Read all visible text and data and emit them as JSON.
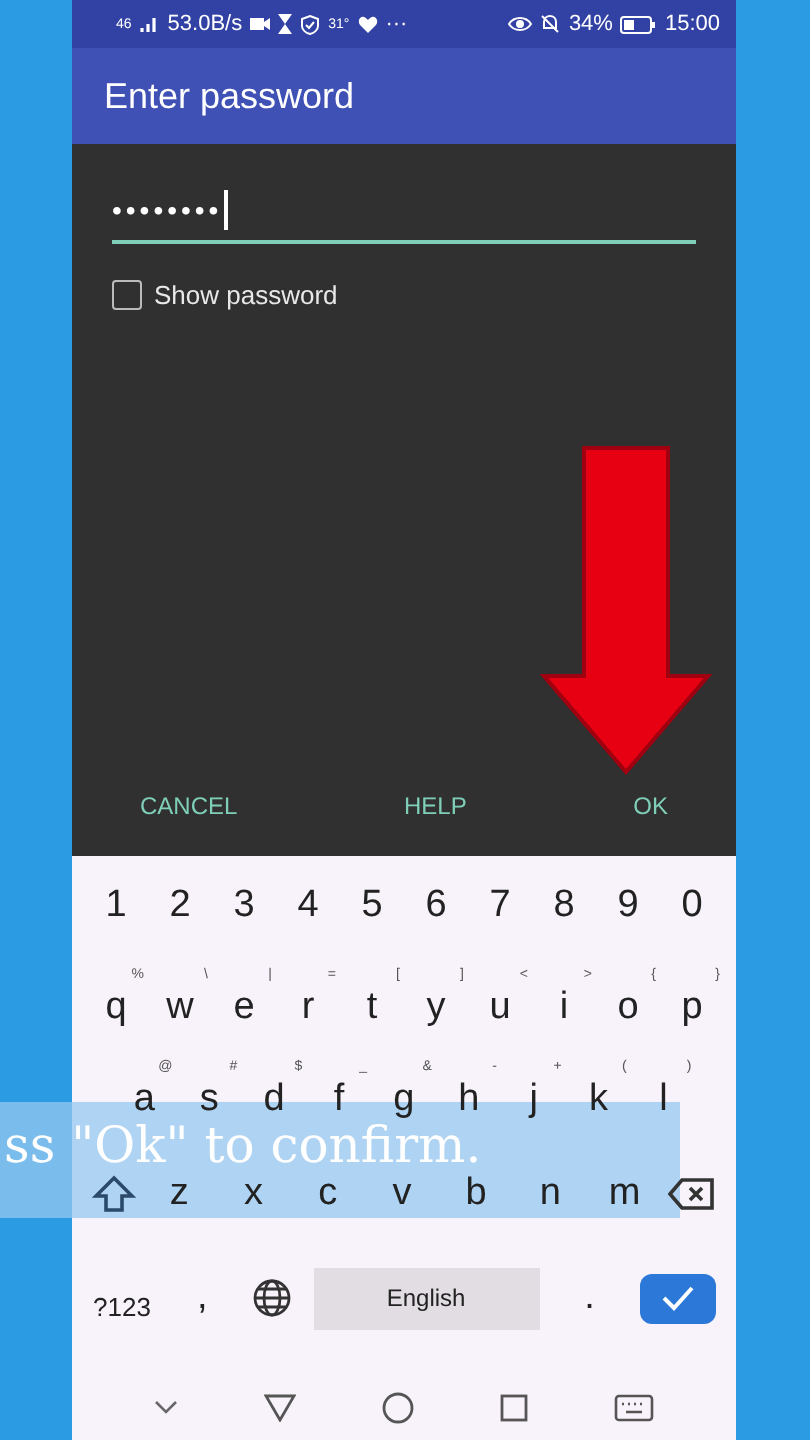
{
  "status_bar": {
    "network": "46",
    "speed": "53.0B/s",
    "temperature": "31°",
    "more": "···",
    "battery": "34%",
    "time": "15:00"
  },
  "app_bar": {
    "title": "Enter password"
  },
  "dialog": {
    "password": {
      "value": "••••••••"
    },
    "show_password": {
      "label": "Show password",
      "checked": false
    },
    "buttons": [
      "CANCEL",
      "HELP",
      "OK"
    ]
  },
  "keyboard": {
    "rows": [
      [
        {
          "label": "1"
        },
        {
          "label": "2"
        },
        {
          "label": "3"
        },
        {
          "label": "4"
        },
        {
          "label": "5"
        },
        {
          "label": "6"
        },
        {
          "label": "7"
        },
        {
          "label": "8"
        },
        {
          "label": "9"
        },
        {
          "label": "0"
        }
      ],
      [
        {
          "label": "q",
          "hint": "%"
        },
        {
          "label": "w",
          "hint": "\\"
        },
        {
          "label": "e",
          "hint": "|"
        },
        {
          "label": "r",
          "hint": "="
        },
        {
          "label": "t",
          "hint": "["
        },
        {
          "label": "y",
          "hint": "]"
        },
        {
          "label": "u",
          "hint": "<"
        },
        {
          "label": "i",
          "hint": ">"
        },
        {
          "label": "o",
          "hint": "{"
        },
        {
          "label": "p",
          "hint": "}"
        }
      ],
      [
        {
          "label": "a",
          "hint": "@"
        },
        {
          "label": "s",
          "hint": "#"
        },
        {
          "label": "d",
          "hint": "$"
        },
        {
          "label": "f",
          "hint": "_"
        },
        {
          "label": "g",
          "hint": "&"
        },
        {
          "label": "h",
          "hint": "-"
        },
        {
          "label": "j",
          "hint": "+"
        },
        {
          "label": "k",
          "hint": "("
        },
        {
          "label": "l",
          "hint": ")"
        }
      ],
      [
        {
          "kind": "shift"
        },
        {
          "label": "z"
        },
        {
          "label": "x"
        },
        {
          "label": "c"
        },
        {
          "label": "v"
        },
        {
          "label": "b"
        },
        {
          "label": "n"
        },
        {
          "label": "m"
        },
        {
          "kind": "backspace"
        }
      ],
      [
        {
          "kind": "symbols",
          "label": "?123"
        },
        {
          "kind": "char",
          "label": ","
        },
        {
          "kind": "globe"
        },
        {
          "kind": "space",
          "label": "English"
        },
        {
          "kind": "char",
          "label": "."
        },
        {
          "kind": "enter"
        }
      ]
    ]
  },
  "caption": "ss \"Ok\" to confirm."
}
